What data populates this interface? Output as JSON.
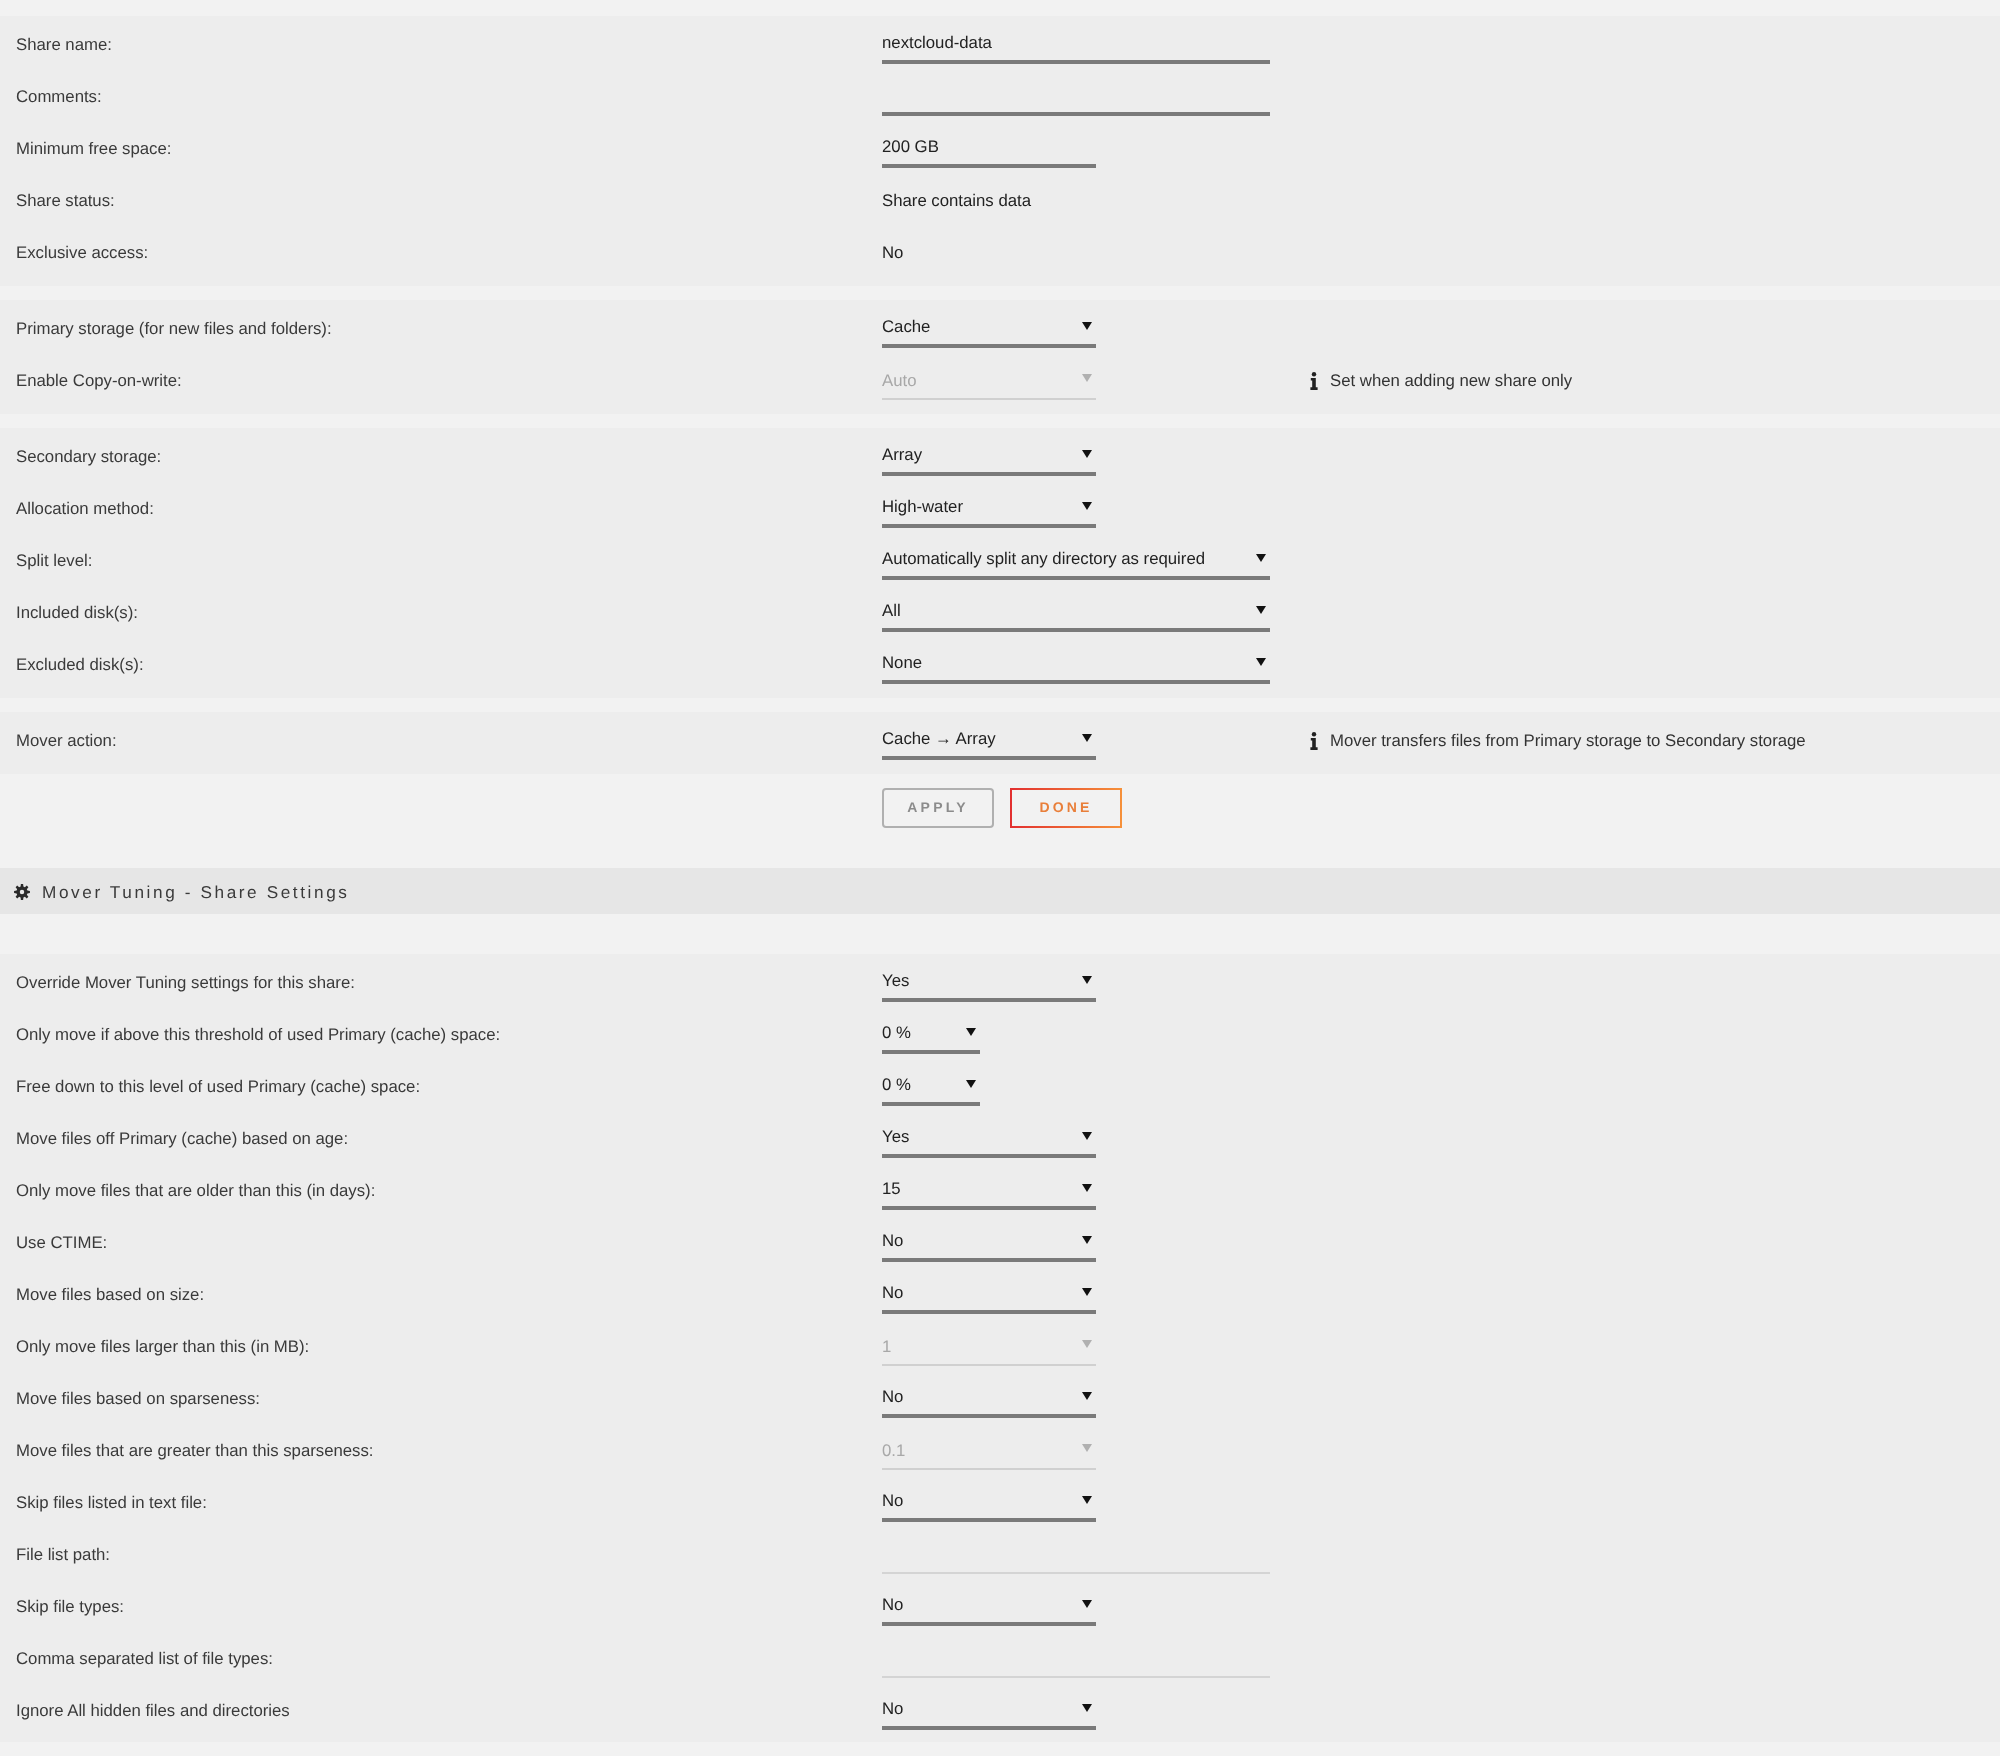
{
  "share_sections": [
    {
      "rows": [
        {
          "label": "Share name:",
          "kind": "text",
          "value": "nextcloud-data",
          "disabled": false
        },
        {
          "label": "Comments:",
          "kind": "text",
          "disabled": false
        },
        {
          "label": "Minimum free space:",
          "kind": "text",
          "value": "200 GB",
          "disabled": false
        },
        {
          "label": "Share status:",
          "kind": "static",
          "value": "Share contains data",
          "disabled": false
        },
        {
          "label": "Exclusive access:",
          "kind": "static",
          "value": "No",
          "disabled": false
        }
      ]
    },
    {
      "rows": [
        {
          "label": "Primary storage (for new files and folders):",
          "kind": "select",
          "value": "Cache",
          "disabled": false
        },
        {
          "label": "Enable Copy-on-write:",
          "kind": "select",
          "value": "Auto",
          "disabled": true,
          "note": "Set when adding new share only"
        }
      ]
    },
    {
      "rows": [
        {
          "label": "Secondary storage:",
          "kind": "select",
          "value": "Array",
          "disabled": false
        },
        {
          "label": "Allocation method:",
          "kind": "select",
          "value": "High-water",
          "disabled": false
        },
        {
          "label": "Split level:",
          "kind": "select",
          "value": "Automatically split any directory as required",
          "disabled": false
        },
        {
          "label": "Included disk(s):",
          "kind": "select",
          "value": "All",
          "disabled": false
        },
        {
          "label": "Excluded disk(s):",
          "kind": "select",
          "value": "None",
          "disabled": false
        }
      ]
    },
    {
      "rows": [
        {
          "label": "Mover action:",
          "kind": "select",
          "value": "Cache → Array",
          "disabled": false,
          "note": "Mover transfers files from Primary storage to Secondary storage"
        }
      ]
    }
  ],
  "buttons": [
    {
      "label": "APPLY",
      "disabled": true
    },
    {
      "label": "DONE",
      "disabled": false
    }
  ],
  "mover_tuning": {
    "title": "Mover Tuning - Share Settings",
    "rows": [
      {
        "label": "Override Mover Tuning settings for this share:",
        "kind": "select",
        "value": "Yes",
        "disabled": false
      },
      {
        "label": "Only move if above this threshold of used Primary (cache) space:",
        "kind": "select",
        "value": "0 %",
        "disabled": false
      },
      {
        "label": "Free down to this level of used Primary (cache) space:",
        "kind": "select",
        "value": "0 %",
        "disabled": false
      },
      {
        "label": "Move files off Primary (cache) based on age:",
        "kind": "select",
        "value": "Yes",
        "disabled": false
      },
      {
        "label": "Only move files that are older than this (in days):",
        "kind": "select",
        "value": "15",
        "disabled": false
      },
      {
        "label": "Use CTIME:",
        "kind": "select",
        "value": "No",
        "disabled": false
      },
      {
        "label": "Move files based on size:",
        "kind": "select",
        "value": "No",
        "disabled": false
      },
      {
        "label": "Only move files larger than this (in MB):",
        "kind": "select",
        "value": "1",
        "disabled": true
      },
      {
        "label": "Move files based on sparseness:",
        "kind": "select",
        "value": "No",
        "disabled": false
      },
      {
        "label": "Move files that are greater than this sparseness:",
        "kind": "select",
        "value": "0.1",
        "disabled": true
      },
      {
        "label": "Skip files listed in text file:",
        "kind": "select",
        "value": "No",
        "disabled": false
      },
      {
        "label": "File list path:",
        "kind": "text",
        "disabled": true
      },
      {
        "label": "Skip file types:",
        "kind": "select",
        "value": "No",
        "disabled": false
      },
      {
        "label": "Comma separated list of file types:",
        "kind": "text",
        "disabled": true
      },
      {
        "label": "Ignore All hidden files and directories",
        "kind": "select",
        "value": "No",
        "disabled": false
      }
    ]
  }
}
